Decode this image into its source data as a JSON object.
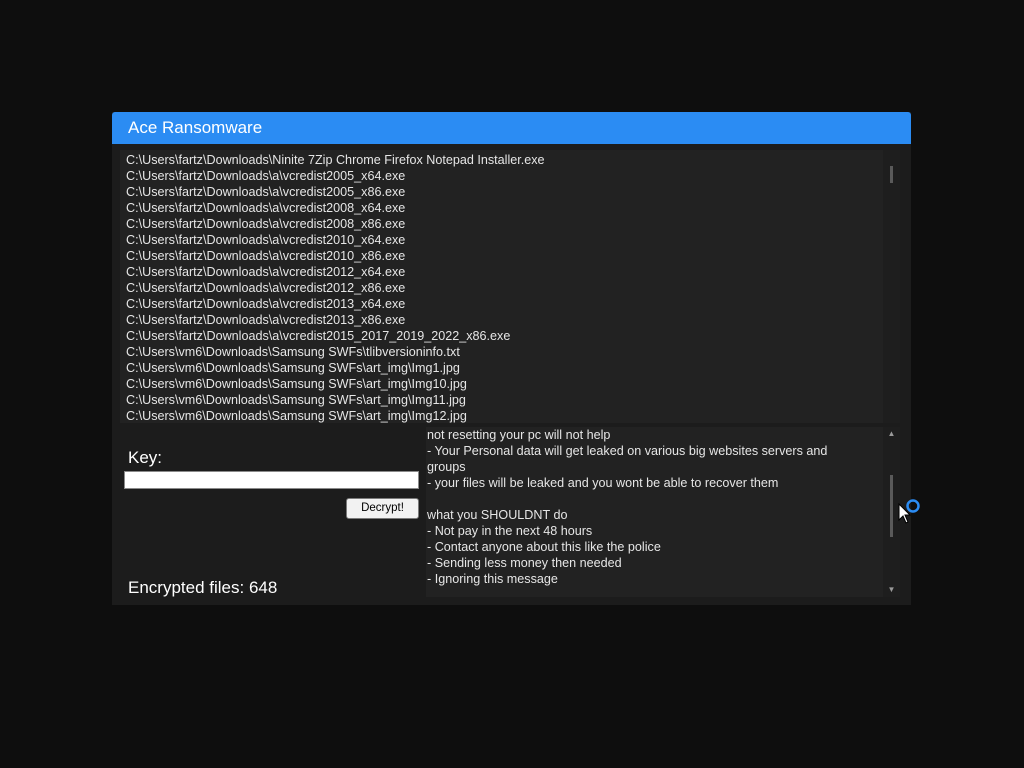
{
  "window": {
    "title": "Ace Ransomware"
  },
  "file_list": {
    "lines": [
      "C:\\Users\\fartz\\Downloads\\Ninite 7Zip Chrome Firefox Notepad Installer.exe",
      "C:\\Users\\fartz\\Downloads\\a\\vcredist2005_x64.exe",
      "C:\\Users\\fartz\\Downloads\\a\\vcredist2005_x86.exe",
      "C:\\Users\\fartz\\Downloads\\a\\vcredist2008_x64.exe",
      "C:\\Users\\fartz\\Downloads\\a\\vcredist2008_x86.exe",
      "C:\\Users\\fartz\\Downloads\\a\\vcredist2010_x64.exe",
      "C:\\Users\\fartz\\Downloads\\a\\vcredist2010_x86.exe",
      "C:\\Users\\fartz\\Downloads\\a\\vcredist2012_x64.exe",
      "C:\\Users\\fartz\\Downloads\\a\\vcredist2012_x86.exe",
      "C:\\Users\\fartz\\Downloads\\a\\vcredist2013_x64.exe",
      "C:\\Users\\fartz\\Downloads\\a\\vcredist2013_x86.exe",
      "C:\\Users\\fartz\\Downloads\\a\\vcredist2015_2017_2019_2022_x86.exe",
      "C:\\Users\\vm6\\Downloads\\Samsung SWFs\\tlibversioninfo.txt",
      "C:\\Users\\vm6\\Downloads\\Samsung SWFs\\art_img\\Img1.jpg",
      "C:\\Users\\vm6\\Downloads\\Samsung SWFs\\art_img\\Img10.jpg",
      "C:\\Users\\vm6\\Downloads\\Samsung SWFs\\art_img\\Img11.jpg",
      "C:\\Users\\vm6\\Downloads\\Samsung SWFs\\art_img\\Img12.jpg"
    ]
  },
  "key": {
    "label": "Key:",
    "value": ""
  },
  "decrypt_button": {
    "label": "Decrypt!"
  },
  "encrypted_files": {
    "text": "Encrypted files: 648"
  },
  "note": {
    "lines": [
      "not resetting your pc will not help",
      "- Your Personal data will get leaked on various big websites servers and groups",
      "- your files will be leaked and you wont be able to recover them",
      "",
      "what you SHOULDNT do",
      "- Not pay in the next 48 hours",
      "- Contact anyone about this like the police",
      "- Sending less money then needed",
      "- Ignoring this message"
    ]
  },
  "icons": {
    "scroll_up": "scroll-up-arrow-icon",
    "scroll_down": "scroll-down-arrow-icon",
    "cursor": "mouse-pointer-icon",
    "busy": "busy-spinner-icon"
  },
  "colors": {
    "titlebar": "#2b8cf3",
    "background": "#0e0e0e",
    "panel": "#222222"
  }
}
